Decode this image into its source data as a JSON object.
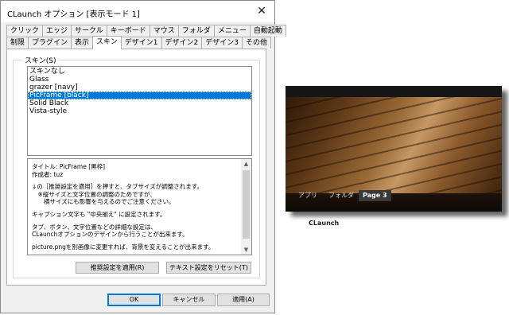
{
  "dialog": {
    "title": "CLaunch オプション [表示モード 1]",
    "close_symbol": "✕"
  },
  "tabs": {
    "row1": [
      "クリック",
      "エッジ",
      "サークル",
      "キーボード",
      "マウス",
      "フォルダ",
      "メニュー",
      "自動起動"
    ],
    "row2": [
      "制限",
      "プラグイン",
      "表示",
      "スキン",
      "デザイン1",
      "デザイン2",
      "デザイン3",
      "その他"
    ],
    "active": "スキン"
  },
  "skin_group": {
    "label": "スキン(S)",
    "items": [
      "スキンなし",
      "Glass",
      "grazer [navy]",
      "PicFrame [black]",
      "Solid Black",
      "Vista-style"
    ],
    "selected_index": 3
  },
  "description": {
    "lines": [
      "タイトル: PicFrame [黒枠]",
      "作成者: tuz",
      "",
      "↓の［推奨設定を適用］を押すと、タブサイズが調整されます。",
      "　※縦サイズと文字位置の調整のためですが、",
      "　　横サイズにも影響を与えるのでご注意ください。",
      "",
      "キャプション文字も \"中央揃え\" に設定されます。",
      "",
      "タブ、ボタン、文字位置などの詳細な設定は、",
      "CLaunchオプションのデザインから行うことが出来ます。",
      "",
      "picture.pngを別画像に変更すれば、背景を変えることが出来ます。"
    ]
  },
  "buttons": {
    "apply_recommended": "推奨設定を適用(R)",
    "reset_text": "テキスト設定をリセット(T)",
    "ok": "OK",
    "cancel": "キャンセル",
    "apply": "適用(A)"
  },
  "preview": {
    "tabs": [
      "アプリ",
      "フォルダ",
      "Page 3"
    ],
    "active_tab": "Page 3",
    "caption": "CLaunch"
  },
  "colors": {
    "selection": "#0078d7",
    "dialog_bg": "#f0f0f0"
  }
}
